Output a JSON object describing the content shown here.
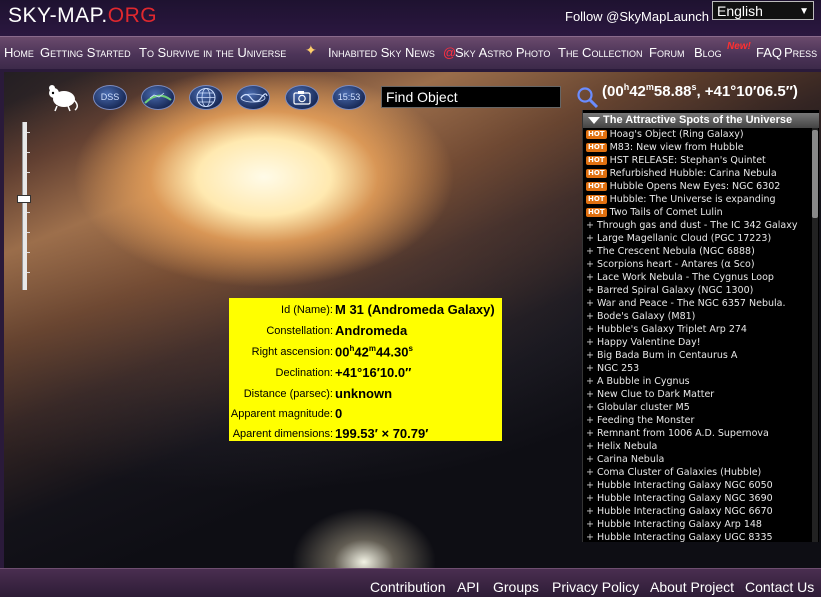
{
  "header": {
    "logo_main": "SKY-MAP.",
    "logo_accent": "ORG",
    "follow": "Follow @SkyMapLaunch",
    "language": "English"
  },
  "nav": {
    "home": "Home",
    "getting_started": "Getting Started",
    "to_survive": "To Survive in the Universe",
    "inhabited_sky_news": "Inhabited Sky News",
    "at_sign": "@",
    "sky_astro_photo": "Sky Astro Photo",
    "collection": "The Collection",
    "forum": "Forum",
    "blog": "Blog",
    "new_badge": "New!",
    "faq": "FAQ",
    "press": "Press"
  },
  "toolbar": {
    "dss_label": "DSS",
    "time_label": "15:53",
    "find_placeholder": "Find Object"
  },
  "coords": {
    "ra_h": "00",
    "ra_m": "42",
    "ra_s": "58.88",
    "dec": ", +41°10′06.5″)"
  },
  "info": {
    "id_label": "Id (Name):",
    "id_value": "M 31 (Andromeda Galaxy)",
    "const_label": "Constellation:",
    "const_value": "Andromeda",
    "ra_label": "Right ascension:",
    "ra_h": "00",
    "ra_m": "42",
    "ra_s": "44.30",
    "dec_label": "Declination:",
    "dec_value": "+41°16′10.0″",
    "dist_label": "Distance (parsec):",
    "dist_value": "unknown",
    "mag_label": "Apparent magnitude:",
    "mag_value": "0",
    "dim_label": "Aparent dimensions:",
    "dim_value": "199.53′ × 70.79′"
  },
  "panel": {
    "title": "The Attractive Spots of the Universe",
    "hot_badge": "HOT",
    "items": [
      {
        "label": "Hoag's Object (Ring Galaxy)",
        "hot": true
      },
      {
        "label": "M83: New view from Hubble",
        "hot": true
      },
      {
        "label": "HST RELEASE: Stephan's Quintet",
        "hot": true
      },
      {
        "label": "Refurbished Hubble: Carina Nebula",
        "hot": true
      },
      {
        "label": "Hubble Opens New Eyes: NGC 6302",
        "hot": true
      },
      {
        "label": "Hubble: The Universe is expanding",
        "hot": true
      },
      {
        "label": "Two Tails of Comet Lulin",
        "hot": true
      },
      {
        "label": "Through gas and dust - The IC 342 Galaxy",
        "hot": false
      },
      {
        "label": "Large Magellanic Cloud (PGC 17223)",
        "hot": false
      },
      {
        "label": "The Crescent Nebula (NGC 6888)",
        "hot": false
      },
      {
        "label": "Scorpions heart - Antares (α Sco)",
        "hot": false
      },
      {
        "label": "Lace Work Nebula - The Cygnus Loop",
        "hot": false
      },
      {
        "label": "Barred Spiral Galaxy (NGC 1300)",
        "hot": false
      },
      {
        "label": "War and Peace - The NGC 6357 Nebula.",
        "hot": false
      },
      {
        "label": "Bode's Galaxy (M81)",
        "hot": false
      },
      {
        "label": "Hubble's Galaxy Triplet Arp 274",
        "hot": false
      },
      {
        "label": "Happy Valentine Day!",
        "hot": false
      },
      {
        "label": "Big Bada Bum in Centaurus A",
        "hot": false
      },
      {
        "label": "NGC 253",
        "hot": false
      },
      {
        "label": "A Bubble in Cygnus",
        "hot": false
      },
      {
        "label": "New Clue to Dark Matter",
        "hot": false
      },
      {
        "label": "Globular cluster M5",
        "hot": false
      },
      {
        "label": "Feeding the Monster",
        "hot": false
      },
      {
        "label": "Remnant from 1006 A.D. Supernova",
        "hot": false
      },
      {
        "label": "Helix Nebula",
        "hot": false
      },
      {
        "label": "Carina Nebula",
        "hot": false
      },
      {
        "label": "Coma Cluster of Galaxies (Hubble)",
        "hot": false
      },
      {
        "label": "Hubble Interacting Galaxy NGC 6050",
        "hot": false
      },
      {
        "label": "Hubble Interacting Galaxy NGC 3690",
        "hot": false
      },
      {
        "label": "Hubble Interacting Galaxy NGC 6670",
        "hot": false
      },
      {
        "label": "Hubble Interacting Galaxy Arp 148",
        "hot": false
      },
      {
        "label": "Hubble Interacting Galaxy UGC 8335",
        "hot": false
      }
    ]
  },
  "footer": {
    "contribution": "Contribution",
    "api": "API",
    "groups": "Groups",
    "privacy": "Privacy Policy",
    "about": "About Project",
    "contact": "Contact Us"
  },
  "colors": {
    "logo_accent": "#e0282e",
    "info_bg": "#ffff00",
    "hot_badge": "#e07010"
  }
}
